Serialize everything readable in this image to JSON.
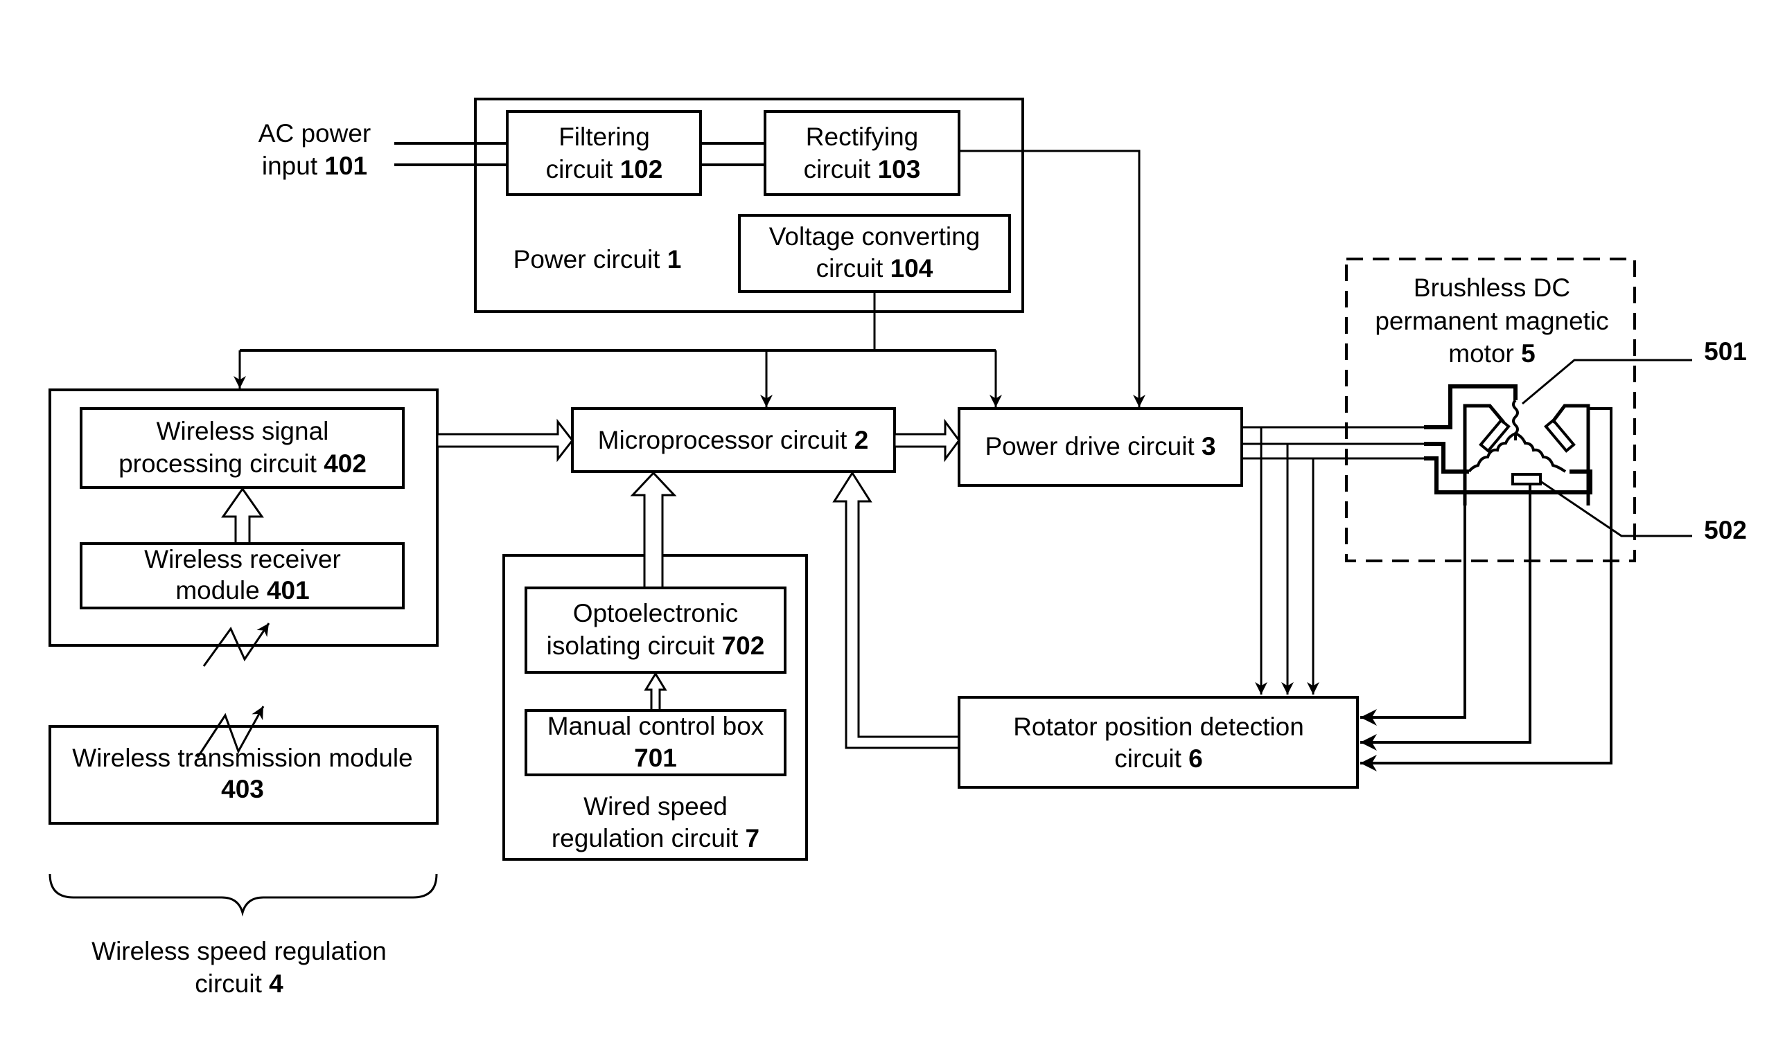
{
  "diagram": {
    "ac_input": {
      "line1": "AC power",
      "line2_text": "input ",
      "line2_num": "101"
    },
    "power_circuit": {
      "label_text": "Power circuit ",
      "label_num": "1"
    },
    "filtering": {
      "line1": "Filtering",
      "line2_text": "circuit ",
      "line2_num": "102"
    },
    "rectifying": {
      "line1": "Rectifying",
      "line2_text": "circuit ",
      "line2_num": "103"
    },
    "voltage_converting": {
      "line1": "Voltage converting",
      "line2_text": "circuit ",
      "line2_num": "104"
    },
    "wireless_signal_processing": {
      "line1": "Wireless signal",
      "line2_text": "processing circuit ",
      "line2_num": "402"
    },
    "wireless_receiver": {
      "line1": "Wireless receiver",
      "line2_text": "module ",
      "line2_num": "401"
    },
    "wireless_transmission": {
      "line1": "Wireless transmission module",
      "line2_num": "403"
    },
    "wireless_speed_regulation": {
      "line1": "Wireless speed regulation",
      "line2_text": "circuit ",
      "line2_num": "4"
    },
    "microprocessor": {
      "text": "Microprocessor circuit ",
      "num": "2"
    },
    "power_drive": {
      "text": "Power drive circuit ",
      "num": "3"
    },
    "optoelectronic": {
      "line1": "Optoelectronic",
      "line2_text": "isolating circuit ",
      "line2_num": "702"
    },
    "manual_control": {
      "line1": "Manual control box",
      "line2_num": "701"
    },
    "wired_speed_regulation": {
      "line1": "Wired speed",
      "line2_text": "regulation circuit ",
      "line2_num": "7"
    },
    "rotator_detection": {
      "line1": "Rotator position detection",
      "line2_text": "circuit ",
      "line2_num": "6"
    },
    "motor": {
      "line1": "Brushless DC",
      "line2": "permanent magnetic",
      "line3_text": "motor ",
      "line3_num": "5"
    },
    "callout_501": "501",
    "callout_502": "502"
  }
}
